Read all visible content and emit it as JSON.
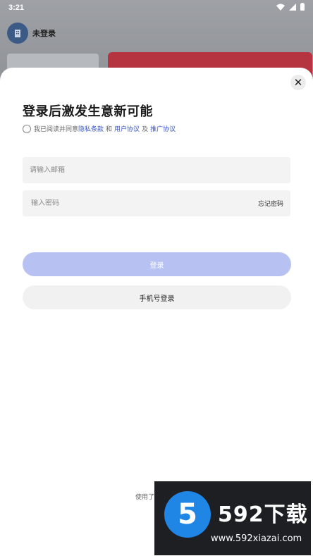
{
  "statusbar": {
    "time": "3:21"
  },
  "background": {
    "login_status": "未登录"
  },
  "sheet": {
    "title": "登录后激发生意新可能",
    "agreement": {
      "prefix": "我已阅读并同意",
      "privacy_link": "隐私条款",
      "and": "和",
      "user_link": "用户协议",
      "and2": "及",
      "promo_link": "推广协议"
    },
    "email_placeholder": "请输入邮箱",
    "password_placeholder": "输入密码",
    "forgot_label": "忘记密码",
    "login_button": "登录",
    "phone_login_button": "手机号登录",
    "footer": "使用了"
  },
  "watermark": {
    "logo_char": "5",
    "title": "592下载",
    "url": "www.592xiazai.com"
  },
  "colors": {
    "accent": "#3a57c8",
    "login_button_bg": "#b8c2f2"
  }
}
